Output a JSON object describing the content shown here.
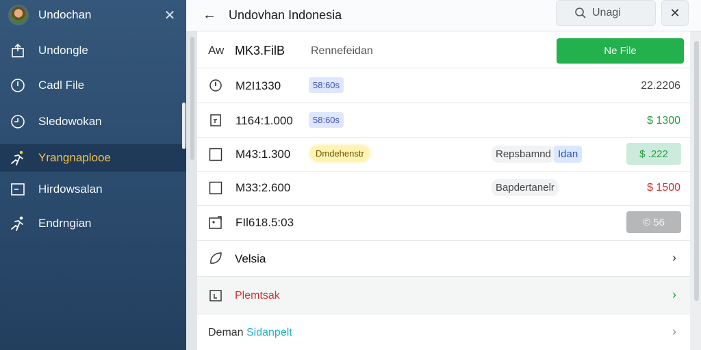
{
  "sidebar": {
    "title": "Undochan",
    "items": [
      {
        "label": "Undongle",
        "icon": "upload-icon"
      },
      {
        "label": "Cadl File",
        "icon": "clock-icon"
      },
      {
        "label": "Sledowokan",
        "icon": "clock-icon"
      },
      {
        "label": "Yrangnaplooe",
        "icon": "run-icon",
        "active": true
      },
      {
        "label": "Hirdowsalan",
        "icon": "box-icon"
      },
      {
        "label": "Endrngian",
        "icon": "run-icon"
      }
    ]
  },
  "header": {
    "title": "Undovhan Indonesia",
    "search_placeholder": "Unagi"
  },
  "list_header": {
    "col1": "Aw",
    "col2": "MK3.FilB",
    "col3": "Rennefeidan",
    "button": "Ne File"
  },
  "rows": [
    {
      "code": "M2I1330",
      "badge": "58:60s",
      "amount": "22.2206",
      "amount_color": "#444444"
    },
    {
      "code": "1164:1.000",
      "badge": "58:60s",
      "amount": "$ 1300",
      "amount_color": "#1f9e3c"
    },
    {
      "code": "M43:1.300",
      "highlight": "Dmdehenstr",
      "tag1": "Repsbamnd",
      "tag2": "Idan",
      "chip": "$ .222"
    },
    {
      "code": "M33:2.600",
      "tag1": "Bapdertanelr",
      "amount": "$ 1500",
      "amount_color": "#d32f2f"
    },
    {
      "code": "FIl618.5:03",
      "chip": "© 56"
    }
  ],
  "nav_rows": [
    {
      "label": "Velsia"
    },
    {
      "label": "Plemtsak"
    },
    {
      "label_a": "Deman",
      "label_b": "Sidanpelt"
    }
  ],
  "colors": {
    "accent_green": "#22b14c",
    "active_label": "#f1c14f",
    "nav_red": "#d32f2f",
    "nav_cyan": "#1fb3c9"
  }
}
